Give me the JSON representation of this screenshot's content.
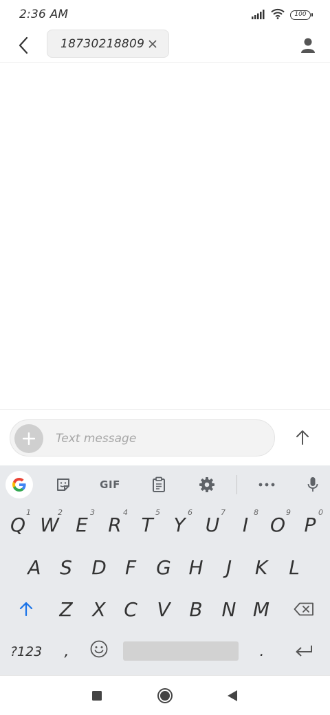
{
  "status_bar": {
    "time": "2:36 AM",
    "battery": "100",
    "icons": [
      "signal-icon",
      "wifi-icon",
      "battery-icon"
    ]
  },
  "header": {
    "back_icon": "back-arrow-icon",
    "recipient": "18730218809",
    "remove_icon": "close-icon",
    "contact_icon": "person-icon"
  },
  "compose": {
    "placeholder": "Text message",
    "value": "",
    "add_icon": "plus-icon",
    "send_icon": "send-arrow-icon"
  },
  "keyboard": {
    "toolbar": {
      "items": [
        "google-icon",
        "sticker-icon",
        "gif-button",
        "clipboard-icon",
        "settings-icon",
        "more-icon",
        "mic-icon"
      ],
      "gif_label": "GIF"
    },
    "row1": [
      {
        "key": "Q",
        "sub": "1"
      },
      {
        "key": "W",
        "sub": "2"
      },
      {
        "key": "E",
        "sub": "3"
      },
      {
        "key": "R",
        "sub": "4"
      },
      {
        "key": "T",
        "sub": "5"
      },
      {
        "key": "Y",
        "sub": "6"
      },
      {
        "key": "U",
        "sub": "7"
      },
      {
        "key": "I",
        "sub": "8"
      },
      {
        "key": "O",
        "sub": "9"
      },
      {
        "key": "P",
        "sub": "0"
      }
    ],
    "row2": [
      "A",
      "S",
      "D",
      "F",
      "G",
      "H",
      "J",
      "K",
      "L"
    ],
    "row3": [
      "Z",
      "X",
      "C",
      "V",
      "B",
      "N",
      "M"
    ],
    "row4": {
      "symbols": "?123",
      "comma": ",",
      "period": "."
    },
    "accent_color": "#1a73e8"
  },
  "nav_bar": {
    "items": [
      "recents-icon",
      "home-icon",
      "back-icon"
    ]
  }
}
